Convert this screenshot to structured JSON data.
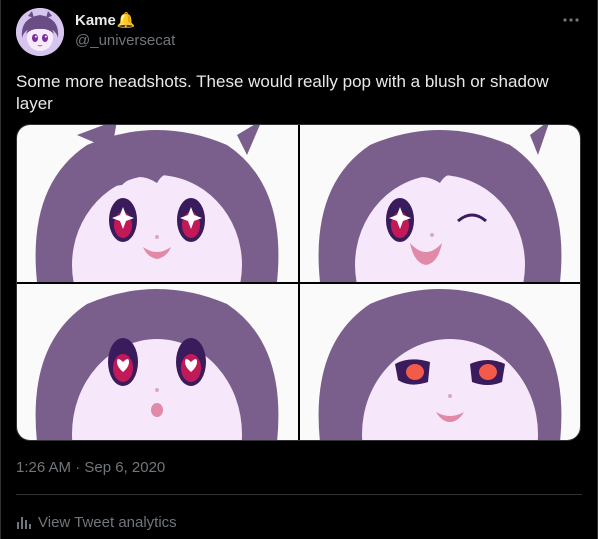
{
  "author": {
    "display_name": "Kame",
    "name_emoji": "🔔",
    "handle": "@_universecat",
    "avatar": "avatar-image"
  },
  "more_icon": "more-icon",
  "tweet": {
    "text": "Some more headshots. These would really pop with a blush or shadow layer",
    "timestamp": "1:26 AM · Sep 6, 2020"
  },
  "media": [
    {
      "icon": "headshot-image",
      "expression": "happy"
    },
    {
      "icon": "headshot-image",
      "expression": "wink"
    },
    {
      "icon": "headshot-image",
      "expression": "surprised"
    },
    {
      "icon": "headshot-image",
      "expression": "smug"
    }
  ],
  "analytics": {
    "icon": "bar-chart-icon",
    "label": "View Tweet analytics"
  },
  "colors": {
    "background": "#000000",
    "text_primary": "#e7e9ea",
    "text_secondary": "#71767b",
    "divider": "#2f3336",
    "hair": "#7a5f8d",
    "skin": "#f6e8fa"
  }
}
